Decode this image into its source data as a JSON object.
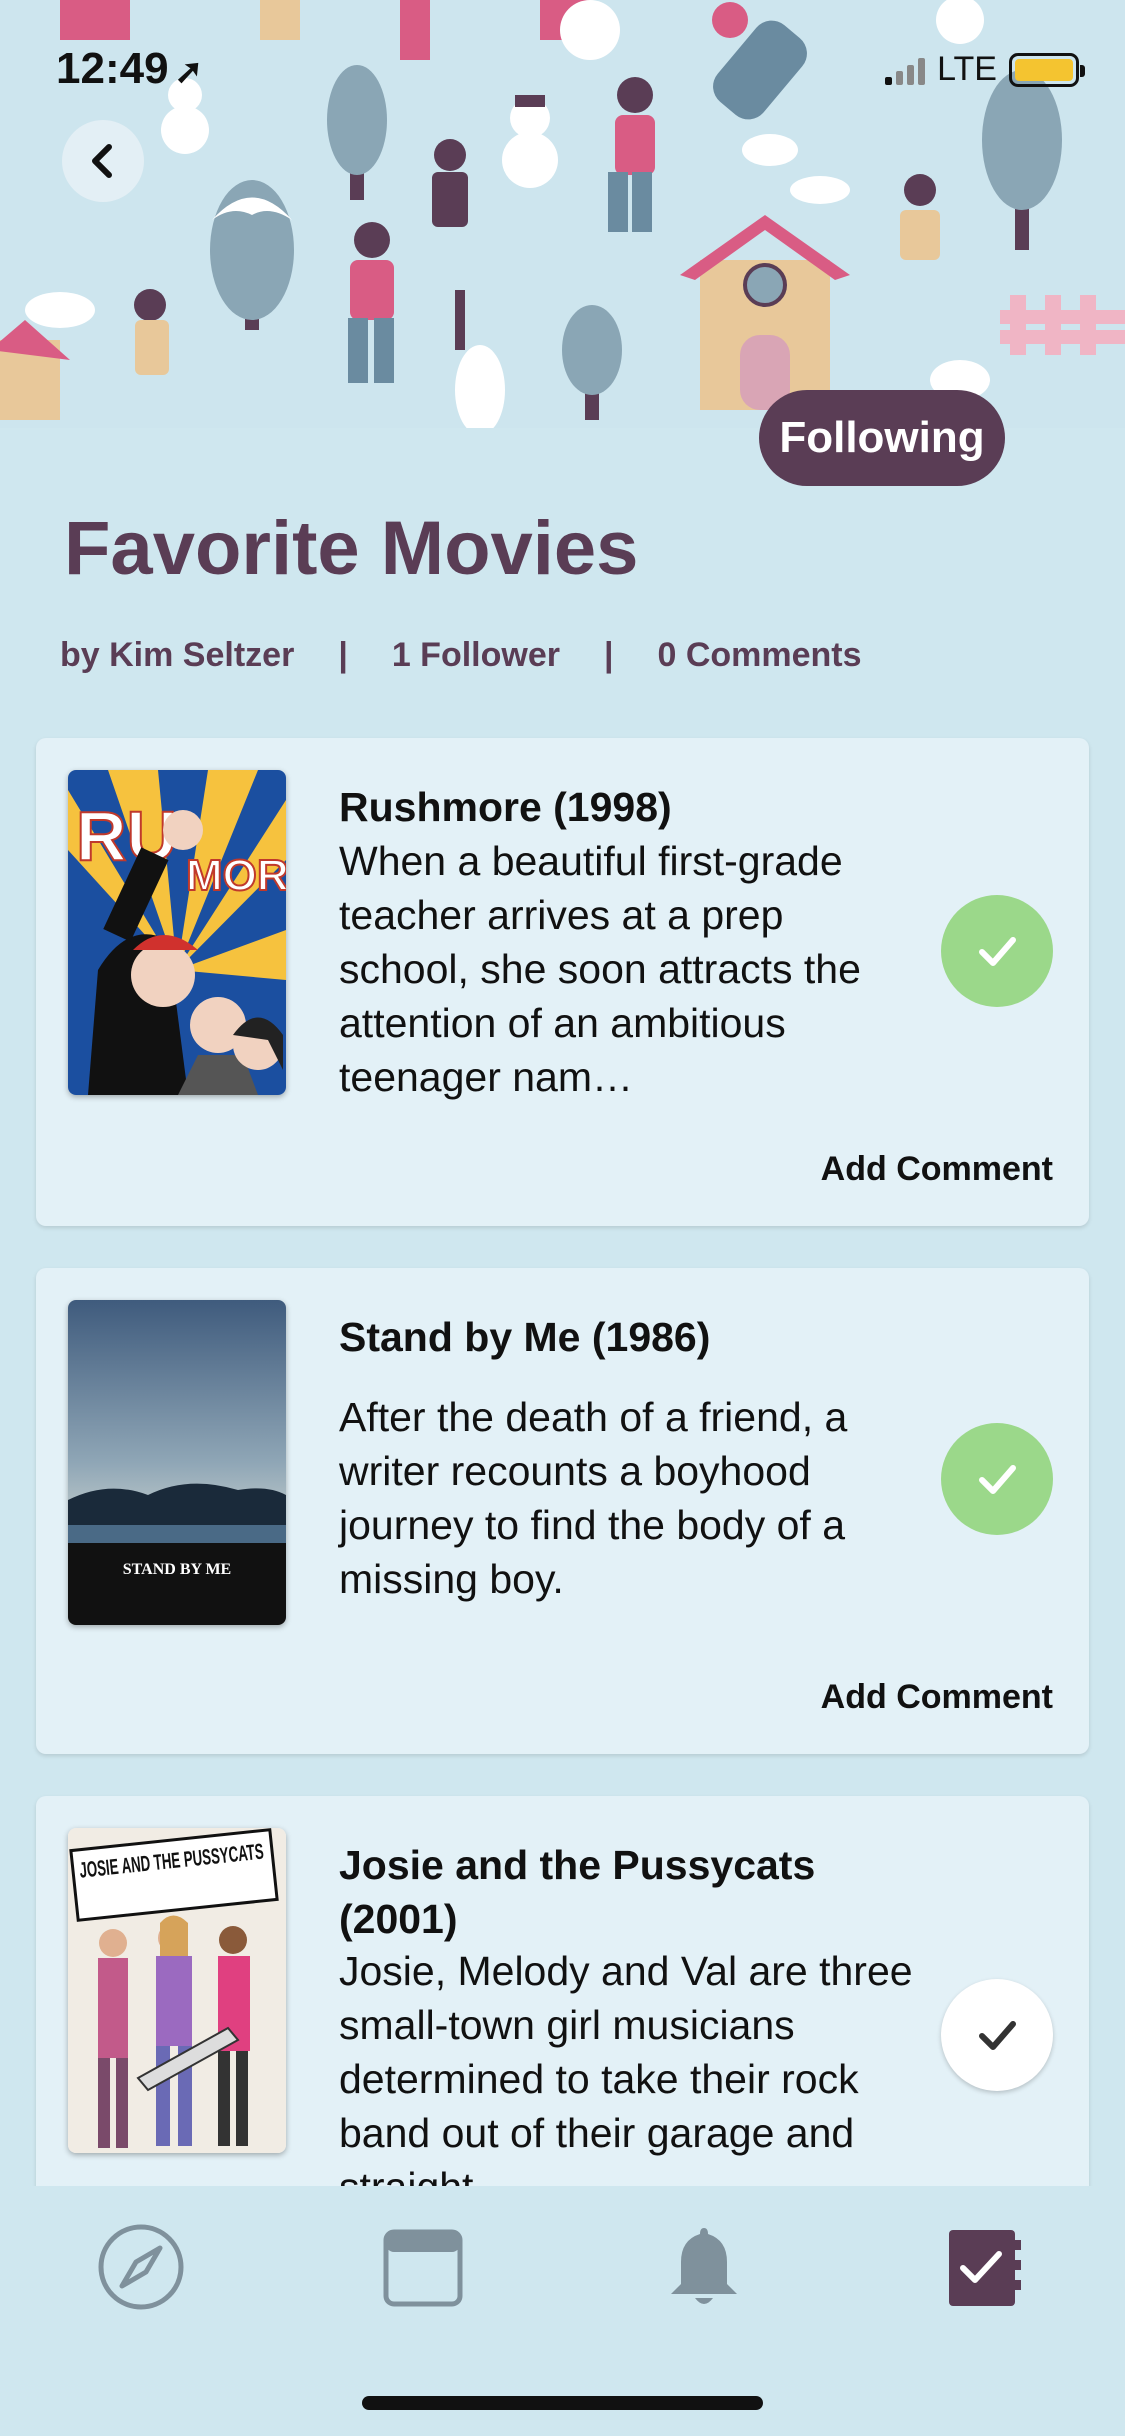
{
  "status_bar": {
    "time": "12:49",
    "network": "LTE"
  },
  "header": {
    "follow_label": "Following"
  },
  "list": {
    "title": "Favorite Movies",
    "author": "by Kim Seltzer",
    "followers": "1 Follower",
    "comments": "0 Comments"
  },
  "movies": [
    {
      "title": "Rushmore (1998)",
      "description": "When a beautiful first-grade teacher arrives at a prep school, she soon attracts the attention of an ambitious teenager nam…",
      "action": "Add Comment",
      "watched": true
    },
    {
      "title": "Stand by Me (1986)",
      "description": "After the death of a friend, a writer recounts a boyhood journey to find the body of a missing boy.",
      "action": "Add Comment",
      "watched": true,
      "poster_text": "STAND BY ME"
    },
    {
      "title": "Josie and the Pussycats (2001)",
      "description": "Josie, Melody and Val are three small-town girl musicians determined to take their rock band out of their garage and straight",
      "watched": false,
      "poster_text": "JOSIE AND THE PUSSYCATS"
    }
  ],
  "tabs": [
    "compass-icon",
    "browser-icon",
    "bell-icon",
    "checklist-icon"
  ],
  "colors": {
    "accent": "#5a3d55",
    "checked": "#9bd88a",
    "background": "#cfe7ef"
  }
}
